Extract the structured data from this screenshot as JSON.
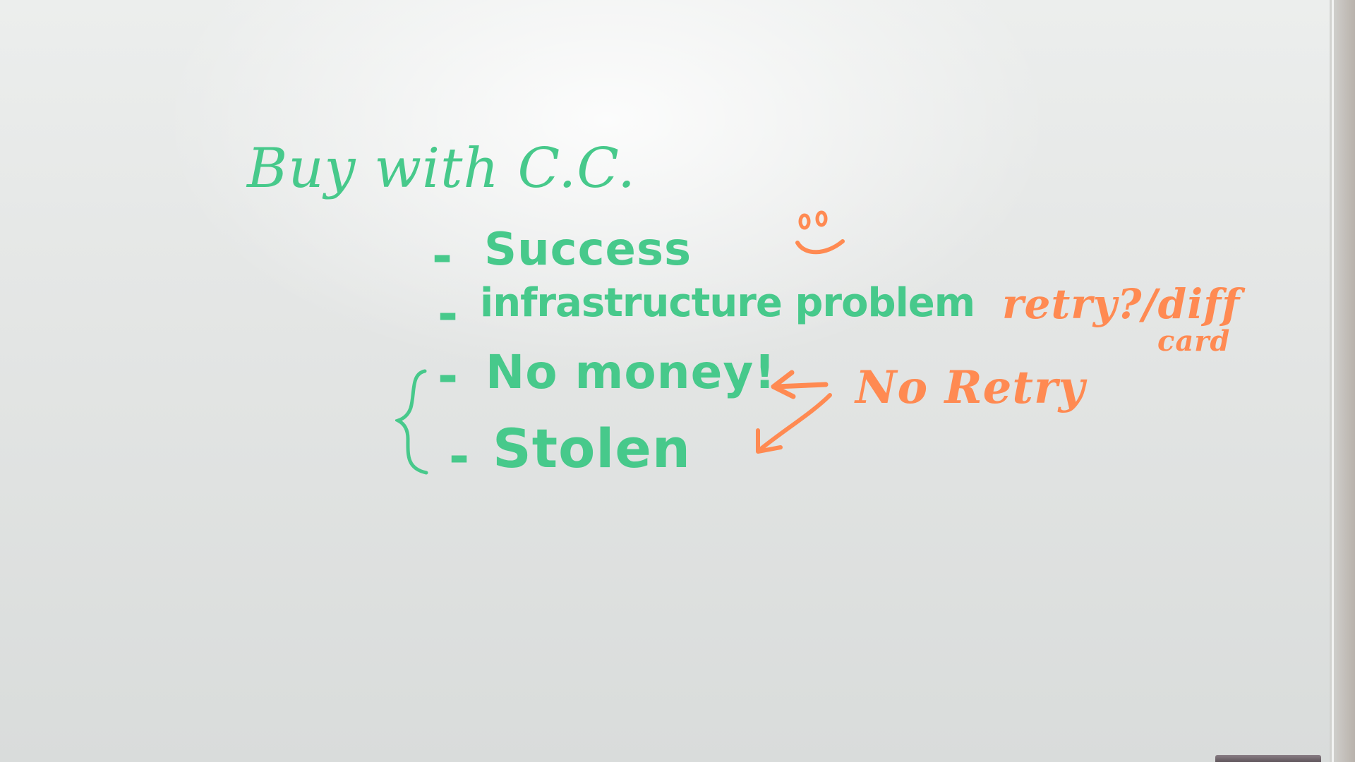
{
  "whiteboard": {
    "title": "Buy with C.C.",
    "items": [
      {
        "dash": "-",
        "text": "Success"
      },
      {
        "dash": "-",
        "text": "infrastructure problem"
      },
      {
        "dash": "-",
        "text": "No money!"
      },
      {
        "dash": "-",
        "text": "Stolen"
      }
    ],
    "annotations": {
      "retry_line1": "retry?/diff",
      "retry_line2": "card",
      "no_retry": "No Retry"
    }
  },
  "colors": {
    "green_marker": "#47c98b",
    "orange_marker": "#ff8a52"
  },
  "icons": [
    "smiley-face-icon",
    "arrow-left-icon",
    "arrow-down-left-icon",
    "curly-brace-icon"
  ]
}
